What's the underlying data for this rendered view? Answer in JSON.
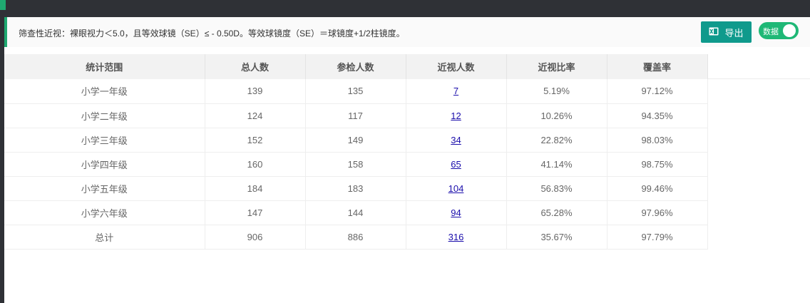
{
  "toolbar": {
    "note": "筛查性近视：裸眼视力＜5.0，且等效球镜（SE）≤ - 0.50D。等效球镜度（SE）＝球镜度+1/2柱镜度。",
    "export_label": "导出",
    "export_icon": "excel-export-icon",
    "toggle_label": "数据",
    "toggle_on": true
  },
  "colors": {
    "accent_green": "#1fa971",
    "button_teal": "#0f9a8c",
    "toggle_green": "#1fb876",
    "link_blue": "#1a0dab"
  },
  "table": {
    "headers": [
      "统计范围",
      "总人数",
      "参检人数",
      "近视人数",
      "近视比率",
      "覆盖率"
    ],
    "rows": [
      {
        "range": "小学一年级",
        "total": "139",
        "examined": "135",
        "myopia": "7",
        "myopia_rate": "5.19%",
        "coverage": "97.12%"
      },
      {
        "range": "小学二年级",
        "total": "124",
        "examined": "117",
        "myopia": "12",
        "myopia_rate": "10.26%",
        "coverage": "94.35%"
      },
      {
        "range": "小学三年级",
        "total": "152",
        "examined": "149",
        "myopia": "34",
        "myopia_rate": "22.82%",
        "coverage": "98.03%"
      },
      {
        "range": "小学四年级",
        "total": "160",
        "examined": "158",
        "myopia": "65",
        "myopia_rate": "41.14%",
        "coverage": "98.75%"
      },
      {
        "range": "小学五年级",
        "total": "184",
        "examined": "183",
        "myopia": "104",
        "myopia_rate": "56.83%",
        "coverage": "99.46%"
      },
      {
        "range": "小学六年级",
        "total": "147",
        "examined": "144",
        "myopia": "94",
        "myopia_rate": "65.28%",
        "coverage": "97.96%"
      },
      {
        "range": "总计",
        "total": "906",
        "examined": "886",
        "myopia": "316",
        "myopia_rate": "35.67%",
        "coverage": "97.79%"
      }
    ]
  }
}
